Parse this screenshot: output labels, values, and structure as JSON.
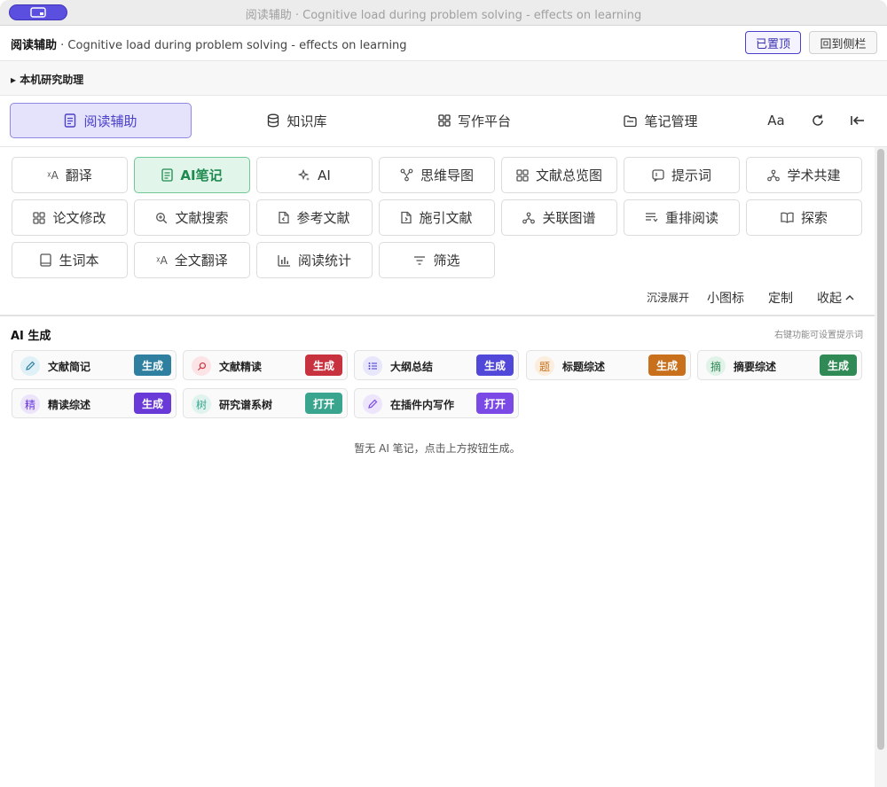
{
  "window": {
    "title": "阅读辅助 · Cognitive load during problem solving - effects on learning"
  },
  "header": {
    "app_name": "阅读辅助",
    "separator": " · ",
    "doc_title": "Cognitive load during problem solving - effects on learning",
    "pin_label": "已置顶",
    "sidebar_label": "回到侧栏"
  },
  "assistant": {
    "label": "▸ 本机研究助理"
  },
  "tabs": [
    {
      "label": "阅读辅助",
      "icon": "document-icon"
    },
    {
      "label": "知识库",
      "icon": "database-icon"
    },
    {
      "label": "写作平台",
      "icon": "grid-icon"
    },
    {
      "label": "笔记管理",
      "icon": "folder-icon"
    }
  ],
  "tab_tools": {
    "font_size": "Aa"
  },
  "features": [
    [
      {
        "label": "翻译",
        "icon": "translate-icon"
      },
      {
        "label": "AI笔记",
        "icon": "note-icon",
        "active": true
      },
      {
        "label": "AI",
        "icon": "sparkle-icon"
      },
      {
        "label": "思维导图",
        "icon": "mindmap-icon"
      },
      {
        "label": "文献总览图",
        "icon": "grid-icon"
      },
      {
        "label": "提示词",
        "icon": "prompt-icon"
      },
      {
        "label": "学术共建",
        "icon": "network-icon"
      }
    ],
    [
      {
        "label": "论文修改",
        "icon": "grid-icon"
      },
      {
        "label": "文献搜索",
        "icon": "search-icon"
      },
      {
        "label": "参考文献",
        "icon": "file-icon"
      },
      {
        "label": "施引文献",
        "icon": "file-icon"
      },
      {
        "label": "关联图谱",
        "icon": "network-icon"
      },
      {
        "label": "重排阅读",
        "icon": "reorder-icon"
      },
      {
        "label": "探索",
        "icon": "book-icon"
      }
    ],
    [
      {
        "label": "生词本",
        "icon": "notebook-icon"
      },
      {
        "label": "全文翻译",
        "icon": "translate-icon"
      },
      {
        "label": "阅读统计",
        "icon": "bar-chart-icon"
      },
      {
        "label": "筛选",
        "icon": "filter-icon"
      }
    ]
  ],
  "options": {
    "immersive": "沉浸展开",
    "small_icons": "小图标",
    "customize": "定制",
    "collapse": "收起"
  },
  "ai_section": {
    "title": "AI 生成",
    "hint": "右键功能可设置提示词",
    "cards": [
      {
        "label": "文献简记",
        "icon_text": "✎",
        "icon": "pencil-icon",
        "action": "生成",
        "color": "#2f7fa0",
        "icon_bg": "#dff0f7",
        "icon_color": "#2f7fa0"
      },
      {
        "label": "文献精读",
        "icon_text": "⌕",
        "icon": "search-icon",
        "action": "生成",
        "color": "#c8323f",
        "icon_bg": "#fbe3e6",
        "icon_color": "#c8323f"
      },
      {
        "label": "大纲总结",
        "icon_text": "☷",
        "icon": "outline-icon",
        "action": "生成",
        "color": "#5147d8",
        "icon_bg": "#e7e6fb",
        "icon_color": "#5147d8"
      },
      {
        "label": "标题综述",
        "icon_text": "题",
        "icon": "title-icon",
        "action": "生成",
        "color": "#c9701c",
        "icon_bg": "#fbeede",
        "icon_color": "#c9701c"
      },
      {
        "label": "摘要综述",
        "icon_text": "摘",
        "icon": "abstract-icon",
        "action": "生成",
        "color": "#2f8a55",
        "icon_bg": "#e1f2e8",
        "icon_color": "#2f8a55"
      },
      {
        "label": "精读综述",
        "icon_text": "精",
        "icon": "review-icon",
        "action": "生成",
        "color": "#6a3ad8",
        "icon_bg": "#ece4fb",
        "icon_color": "#6a3ad8"
      },
      {
        "label": "研究谱系树",
        "icon_text": "树",
        "icon": "tree-icon",
        "action": "打开",
        "color": "#3aa58e",
        "icon_bg": "#e0f3ee",
        "icon_color": "#3aa58e"
      },
      {
        "label": "在插件内写作",
        "icon_text": "✎",
        "icon": "pencil-icon",
        "action": "打开",
        "color": "#7b4ae6",
        "icon_bg": "#ece5fb",
        "icon_color": "#7b4ae6"
      }
    ]
  },
  "empty_message": "暂无 AI 笔记，点击上方按钮生成。"
}
